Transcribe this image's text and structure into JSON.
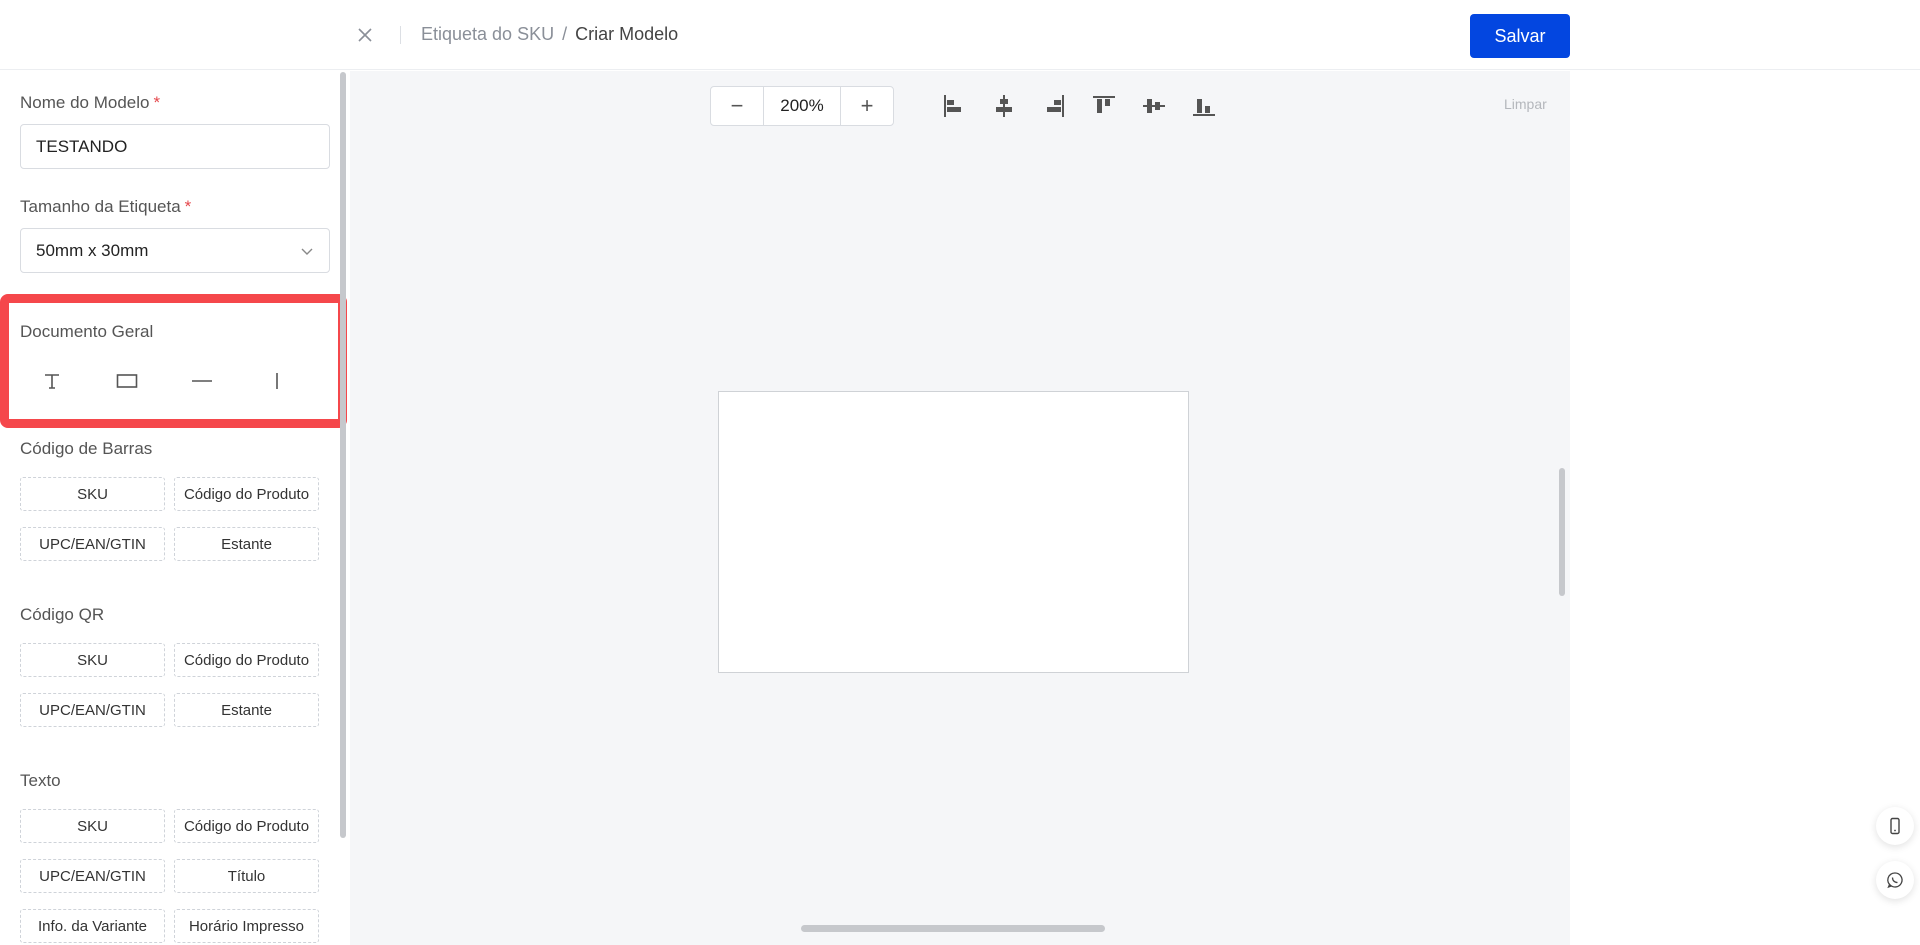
{
  "header": {
    "breadcrumb": [
      "Etiqueta do SKU",
      "Criar Modelo"
    ],
    "breadcrumb_separator": "/",
    "save_label": "Salvar",
    "close_icon": "close-icon"
  },
  "form": {
    "name_label": "Nome do Modelo",
    "name_value": "TESTANDO",
    "size_label": "Tamanho da Etiqueta",
    "size_value": "50mm x 30mm",
    "required_mark": "*"
  },
  "general": {
    "title": "Documento Geral",
    "tools": [
      "text-tool-icon",
      "rectangle-tool-icon",
      "horizontal-line-tool-icon",
      "vertical-line-tool-icon"
    ]
  },
  "barcode": {
    "title": "Código de Barras",
    "items": [
      "SKU",
      "Código do Produto",
      "UPC/EAN/GTIN",
      "Estante"
    ]
  },
  "qrcode": {
    "title": "Código QR",
    "items": [
      "SKU",
      "Código do Produto",
      "UPC/EAN/GTIN",
      "Estante"
    ]
  },
  "text": {
    "title": "Texto",
    "items": [
      "SKU",
      "Código do Produto",
      "UPC/EAN/GTIN",
      "Título",
      "Info. da Variante",
      "Horário Impresso"
    ]
  },
  "canvas": {
    "zoom_value": "200%",
    "zoom_out": "−",
    "zoom_in": "+",
    "clear_label": "Limpar",
    "align_tools": [
      "align-left-icon",
      "align-center-horizontal-icon",
      "align-right-icon",
      "align-top-icon",
      "align-middle-vertical-icon",
      "align-bottom-icon"
    ]
  },
  "colors": {
    "primary": "#0346e0",
    "highlight": "#f5474b",
    "canvas_bg": "#f5f6f8"
  }
}
